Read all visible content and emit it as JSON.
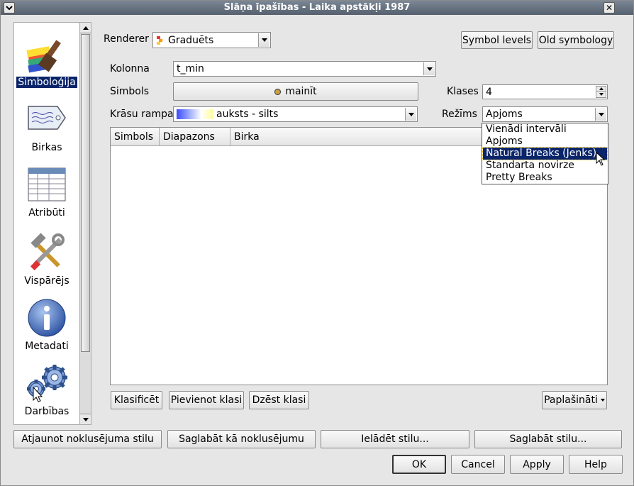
{
  "window": {
    "title": "Slāņa īpašības - Laika apstākļi 1987"
  },
  "colors": {
    "titlebar": "#5f6a78",
    "selection": "#0a246a",
    "ramp_start": "#3a4cff",
    "ramp_end": "#fffd9a"
  },
  "sidebar": {
    "items": [
      {
        "label": "Simboloģija",
        "icon": "brush-icon"
      },
      {
        "label": "Birkas",
        "icon": "tag-icon"
      },
      {
        "label": "Atribūti",
        "icon": "table-icon"
      },
      {
        "label": "Vispārējs",
        "icon": "tools-icon"
      },
      {
        "label": "Metadati",
        "icon": "info-icon"
      },
      {
        "label": "Darbības",
        "icon": "gears-icon"
      }
    ]
  },
  "renderer": {
    "label": "Renderer",
    "value": "Graduēts"
  },
  "top_buttons": {
    "symbol_levels": "Symbol levels",
    "old_symbology": "Old symbology"
  },
  "form": {
    "kolonna_label": "Kolonna",
    "kolonna_value": "t_min",
    "simbols_label": "Simbols",
    "simbols_button": "mainīt",
    "klases_label": "Klases",
    "klases_value": "4",
    "rampa_label": "Krāsu rampa",
    "rampa_value": "auksts - silts",
    "rezims_label": "Režīms",
    "rezims_value": "Apjoms"
  },
  "table": {
    "columns": [
      "Simbols",
      "Diapazons",
      "Birka"
    ]
  },
  "dropdown": {
    "options": [
      "Vienādi intervāli",
      "Apjoms",
      "Natural Breaks (Jenks)",
      "Standarta novirze",
      "Pretty Breaks"
    ],
    "highlighted": "Natural Breaks (Jenks)"
  },
  "table_buttons": {
    "classify": "Klasificēt",
    "add": "Pievienot klasi",
    "delete": "Dzēst klasi",
    "advanced": "Paplašināti"
  },
  "style_buttons": {
    "restore": "Atjaunot noklusējuma stilu",
    "save_default": "Saglabāt kā noklusējumu",
    "load": "Ielādēt stilu...",
    "save": "Saglabāt stilu..."
  },
  "dialog_buttons": {
    "ok": "OK",
    "cancel": "Cancel",
    "apply": "Apply",
    "help": "Help"
  }
}
